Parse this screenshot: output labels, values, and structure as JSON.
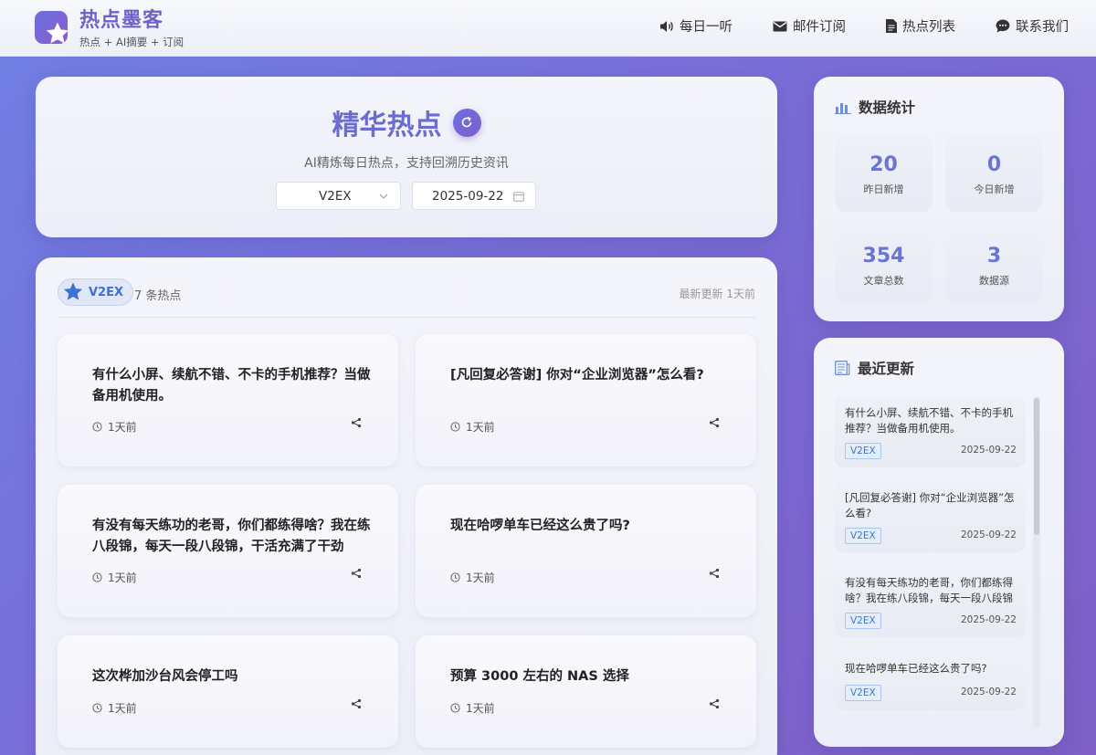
{
  "brand": {
    "title": "热点墨客",
    "subtitle": "热点 + AI摘要 + 订阅",
    "logo_icon": "star-icon"
  },
  "nav": [
    {
      "label": "每日一听",
      "icon": "speaker-icon"
    },
    {
      "label": "邮件订阅",
      "icon": "mail-icon"
    },
    {
      "label": "热点列表",
      "icon": "document-icon"
    },
    {
      "label": "联系我们",
      "icon": "chat-icon"
    }
  ],
  "hero": {
    "title": "精华热点",
    "subtitle": "AI精炼每日热点，支持回溯历史资讯",
    "source_select": "V2EX",
    "date_picker": "2025-09-22"
  },
  "list": {
    "source_badge": "V2EX",
    "count": "7 条热点",
    "updated": "最新更新 1天前",
    "items": [
      {
        "title": "有什么小屏、续航不错、不卡的手机推荐？当做备用机使用。",
        "time": "1天前"
      },
      {
        "title": "[凡回复必答谢] 你对“企业浏览器”怎么看?",
        "time": "1天前"
      },
      {
        "title": "有没有每天练功的老哥，你们都练得啥？我在练八段锦，每天一段八段锦，干活充满了干劲",
        "time": "1天前"
      },
      {
        "title": "现在哈啰单车已经这么贵了吗?",
        "time": "1天前"
      },
      {
        "title": "这次桦加沙台风会停工吗",
        "time": "1天前"
      },
      {
        "title": "预算 3000 左右的 NAS 选择",
        "time": "1天前"
      }
    ]
  },
  "stats": {
    "title": "数据统计",
    "boxes": [
      {
        "value": "20",
        "label": "昨日新增"
      },
      {
        "value": "0",
        "label": "今日新增"
      },
      {
        "value": "354",
        "label": "文章总数"
      },
      {
        "value": "3",
        "label": "数据源"
      }
    ]
  },
  "recent": {
    "title": "最近更新",
    "items": [
      {
        "title": "有什么小屏、续航不错、不卡的手机推荐？当做备用机使用。",
        "tag": "V2EX",
        "date": "2025-09-22"
      },
      {
        "title": "[凡回复必答谢] 你对“企业浏览器”怎么看?",
        "tag": "V2EX",
        "date": "2025-09-22"
      },
      {
        "title": "有没有每天练功的老哥，你们都练得啥？我在练八段锦，每天一段八段锦",
        "tag": "V2EX",
        "date": "2025-09-22"
      },
      {
        "title": "现在哈啰单车已经这么贵了吗?",
        "tag": "V2EX",
        "date": "2025-09-22"
      }
    ]
  },
  "colors": {
    "accent": "#6d62c8",
    "stat_number": "#6a74d4",
    "badge_blue": "#3d6fd4"
  }
}
